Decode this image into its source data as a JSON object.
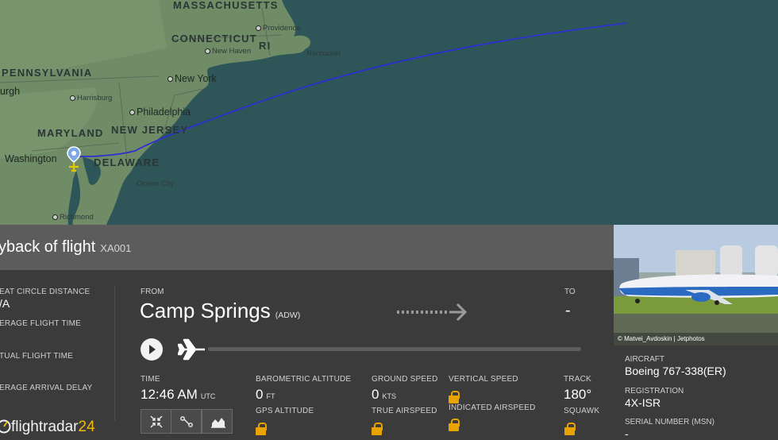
{
  "map": {
    "states": [
      "MASSACHUSETTS",
      "CONNECTICUT",
      "RI",
      "PENNSYLVANIA",
      "MARYLAND",
      "NEW JERSEY",
      "DELAWARE"
    ],
    "cities": [
      "Providence",
      "New Haven",
      "Nantucket",
      "New York",
      "Harrisburg",
      "Philadelphia",
      "Washington",
      "Ocean City",
      "Richmond",
      "urgh"
    ]
  },
  "header": {
    "title": "yback of flight",
    "flight": "XA001"
  },
  "stats": {
    "great_circle_label": "EAT CIRCLE DISTANCE",
    "great_circle_value": "/A",
    "avg_flight_time_label": "ERAGE FLIGHT TIME",
    "actual_flight_time_label": "TUAL FLIGHT TIME",
    "avg_arrival_delay_label": "ERAGE ARRIVAL DELAY"
  },
  "route": {
    "from_label": "FROM",
    "from_city": "Camp Springs",
    "from_code": "(ADW)",
    "to_label": "TO",
    "to_value": "-"
  },
  "telemetry": {
    "time_label": "TIME",
    "time_value": "12:46 AM",
    "time_zone": "UTC",
    "baro_label": "BAROMETRIC ALTITUDE",
    "baro_value": "0",
    "baro_unit": "FT",
    "gps_label": "GPS ALTITUDE",
    "ground_speed_label": "GROUND SPEED",
    "ground_speed_value": "0",
    "ground_speed_unit": "KTS",
    "true_airspeed_label": "TRUE AIRSPEED",
    "vertical_speed_label": "VERTICAL SPEED",
    "indicated_airspeed_label": "INDICATED AIRSPEED",
    "track_label": "TRACK",
    "track_value": "180°",
    "squawk_label": "SQUAWK"
  },
  "playback": {
    "progress": 0
  },
  "brand": {
    "name": "flightradar",
    "number": "24"
  },
  "aircraft": {
    "photo_credit": "© Matvei_Avdoskin | Jetphotos",
    "aircraft_label": "AIRCRAFT",
    "aircraft_value": "Boeing 767-338(ER)",
    "registration_label": "REGISTRATION",
    "registration_value": "4X-ISR",
    "serial_label": "SERIAL NUMBER (MSN)",
    "serial_value": "-"
  },
  "colors": {
    "track_line": "#2f2fd0",
    "lock": "#e8a300",
    "brand_accent": "#f5b800"
  }
}
